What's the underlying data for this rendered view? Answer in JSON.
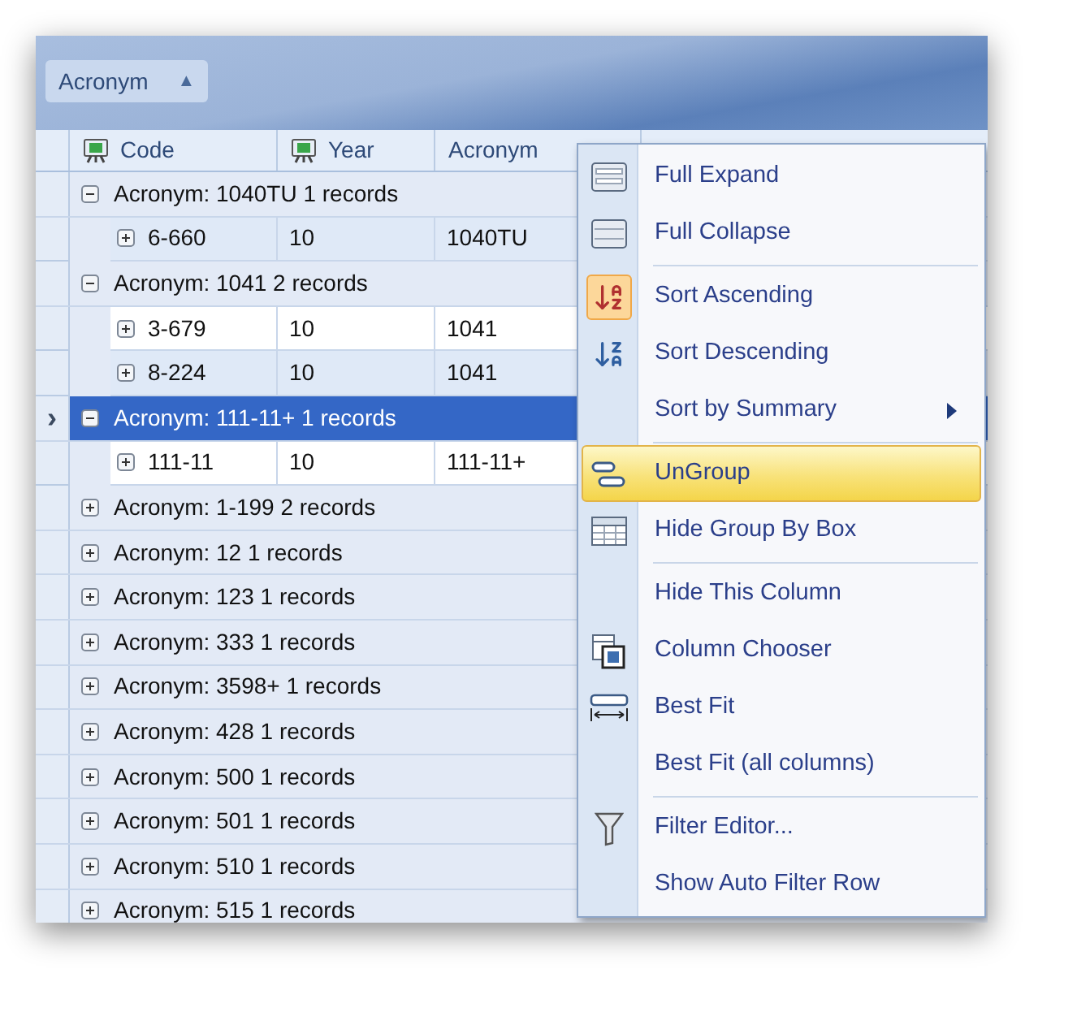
{
  "group_panel": {
    "chips": [
      {
        "label": "Acronym",
        "sort_glyph": "▲"
      }
    ]
  },
  "columns": [
    {
      "label": "Code",
      "icon": true
    },
    {
      "label": "Year",
      "icon": true
    },
    {
      "label": "Acronym",
      "icon": false
    }
  ],
  "indicator_glyph": "›",
  "groups": [
    {
      "label": "Acronym: 1040TU 1 records",
      "expanded": true,
      "selected": false,
      "rows": [
        {
          "code": "6-660",
          "year": "10",
          "acronym": "1040TU",
          "expanded": false
        }
      ]
    },
    {
      "label": "Acronym: 1041 2 records",
      "expanded": true,
      "selected": false,
      "rows": [
        {
          "code": "3-679",
          "year": "10",
          "acronym": "1041",
          "expanded": false
        },
        {
          "code": "8-224",
          "year": "10",
          "acronym": "1041",
          "expanded": false
        }
      ]
    },
    {
      "label": "Acronym: 111-11+ 1 records",
      "expanded": true,
      "selected": true,
      "rows": [
        {
          "code": "111-11",
          "year": "10",
          "acronym": "111-11+",
          "expanded": false
        }
      ]
    },
    {
      "label": "Acronym: 1-199 2 records",
      "expanded": false,
      "selected": false
    },
    {
      "label": "Acronym: 12 1 records",
      "expanded": false,
      "selected": false
    },
    {
      "label": "Acronym: 123 1 records",
      "expanded": false,
      "selected": false
    },
    {
      "label": "Acronym: 333 1 records",
      "expanded": false,
      "selected": false
    },
    {
      "label": "Acronym: 3598+ 1 records",
      "expanded": false,
      "selected": false
    },
    {
      "label": "Acronym: 428 1 records",
      "expanded": false,
      "selected": false
    },
    {
      "label": "Acronym: 500 1 records",
      "expanded": false,
      "selected": false
    },
    {
      "label": "Acronym: 501 1 records",
      "expanded": false,
      "selected": false
    },
    {
      "label": "Acronym: 510 1 records",
      "expanded": false,
      "selected": false
    },
    {
      "label": "Acronym: 515 1 records",
      "expanded": false,
      "selected": false
    }
  ],
  "context_menu": {
    "items": [
      {
        "label": "Full Expand",
        "kind": "expand",
        "checked": false,
        "selected": false,
        "submenu": false
      },
      {
        "label": "Full Collapse",
        "kind": "collapse",
        "checked": false,
        "selected": false,
        "submenu": false
      },
      {
        "kind": "separator"
      },
      {
        "label": "Sort Ascending",
        "kind": "sort-asc",
        "checked": true,
        "selected": false,
        "submenu": false
      },
      {
        "label": "Sort Descending",
        "kind": "sort-desc",
        "checked": false,
        "selected": false,
        "submenu": false
      },
      {
        "label": "Sort by Summary",
        "kind": "none",
        "checked": false,
        "selected": false,
        "submenu": true
      },
      {
        "kind": "separator"
      },
      {
        "label": "UnGroup",
        "kind": "ungroup",
        "checked": false,
        "selected": true,
        "submenu": false
      },
      {
        "label": "Hide Group By Box",
        "kind": "table",
        "checked": false,
        "selected": false,
        "submenu": false
      },
      {
        "kind": "separator"
      },
      {
        "label": "Hide This Column",
        "kind": "none",
        "checked": false,
        "selected": false,
        "submenu": false
      },
      {
        "label": "Column Chooser",
        "kind": "chooser",
        "checked": false,
        "selected": false,
        "submenu": false
      },
      {
        "label": "Best Fit",
        "kind": "bestfit",
        "checked": false,
        "selected": false,
        "submenu": false
      },
      {
        "label": "Best Fit (all columns)",
        "kind": "none",
        "checked": false,
        "selected": false,
        "submenu": false
      },
      {
        "kind": "separator"
      },
      {
        "label": "Filter Editor...",
        "kind": "filter",
        "checked": false,
        "selected": false,
        "submenu": false
      },
      {
        "label": "Show Auto Filter Row",
        "kind": "none",
        "checked": false,
        "selected": false,
        "submenu": false
      }
    ]
  }
}
